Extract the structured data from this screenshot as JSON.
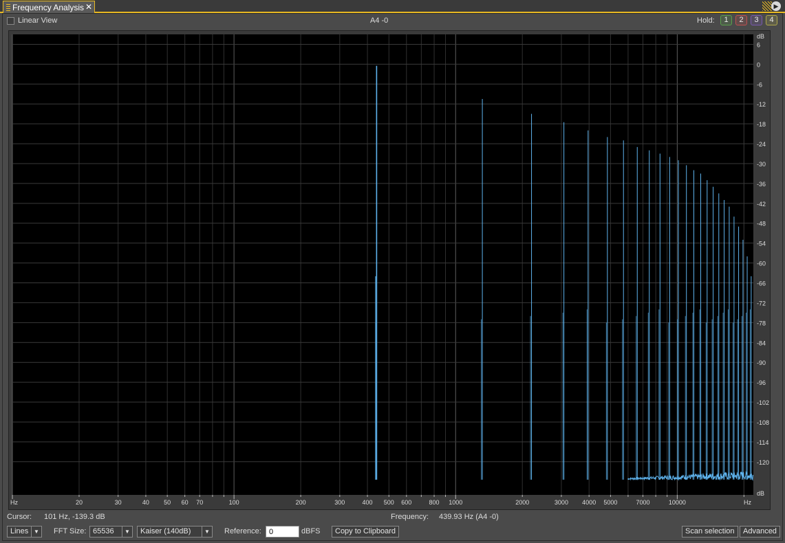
{
  "tab": {
    "title": "Frequency Analysis",
    "close_glyph": "✕"
  },
  "toolbar": {
    "linear_view_label": "Linear View",
    "note_readout": "A4 -0",
    "hold_label": "Hold:",
    "hold_buttons": [
      {
        "label": "1",
        "color": "#5aa04a"
      },
      {
        "label": "2",
        "color": "#c05050"
      },
      {
        "label": "3",
        "color": "#7a5ab0"
      },
      {
        "label": "4",
        "color": "#b0a84a"
      }
    ]
  },
  "status": {
    "cursor_label": "Cursor:",
    "cursor_value": "101 Hz, -139.3 dB",
    "frequency_label": "Frequency:",
    "frequency_value": "439.93 Hz (A4 -0)"
  },
  "controls": {
    "display_mode": "Lines",
    "fft_size_label": "FFT Size:",
    "fft_size": "65536",
    "window": "Kaiser (140dB)",
    "reference_label": "Reference:",
    "reference_value": "0",
    "reference_unit": "dBFS",
    "copy_button": "Copy to Clipboard",
    "scan_button": "Scan selection",
    "advanced_button": "Advanced"
  },
  "chart_data": {
    "type": "line",
    "x_scale": "log",
    "xlim": [
      10,
      22050
    ],
    "ylim": [
      -130,
      9
    ],
    "x_axis_unit_left": "Hz",
    "x_axis_unit_right": "Hz",
    "y_axis_unit_top": "dB",
    "y_axis_unit_bottom": "dB",
    "x_tick_labels": [
      {
        "value": 20,
        "label": "20"
      },
      {
        "value": 30,
        "label": "30"
      },
      {
        "value": 40,
        "label": "40"
      },
      {
        "value": 50,
        "label": "50"
      },
      {
        "value": 60,
        "label": "60"
      },
      {
        "value": 70,
        "label": "70"
      },
      {
        "value": 100,
        "label": "100"
      },
      {
        "value": 200,
        "label": "200"
      },
      {
        "value": 300,
        "label": "300"
      },
      {
        "value": 400,
        "label": "400"
      },
      {
        "value": 500,
        "label": "500"
      },
      {
        "value": 600,
        "label": "600"
      },
      {
        "value": 800,
        "label": "800"
      },
      {
        "value": 1000,
        "label": "1000"
      },
      {
        "value": 2000,
        "label": "2000"
      },
      {
        "value": 3000,
        "label": "3000"
      },
      {
        "value": 4000,
        "label": "4000"
      },
      {
        "value": 5000,
        "label": "5000"
      },
      {
        "value": 7000,
        "label": "7000"
      },
      {
        "value": 10000,
        "label": "10000"
      }
    ],
    "y_ticks": [
      6,
      0,
      -6,
      -12,
      -18,
      -24,
      -30,
      -36,
      -42,
      -48,
      -54,
      -60,
      -66,
      -72,
      -78,
      -84,
      -90,
      -96,
      -102,
      -108,
      -114,
      -120
    ],
    "grid": true,
    "series": [
      {
        "color": "#5fb4ee",
        "peaks": [
          {
            "x": 440,
            "y": -0.5
          },
          {
            "x": 1320,
            "y": -10.5
          },
          {
            "x": 2200,
            "y": -15
          },
          {
            "x": 3080,
            "y": -17.5
          },
          {
            "x": 3960,
            "y": -20
          },
          {
            "x": 4840,
            "y": -22
          },
          {
            "x": 5720,
            "y": -23
          },
          {
            "x": 6600,
            "y": -25
          },
          {
            "x": 7480,
            "y": -26
          },
          {
            "x": 8360,
            "y": -27
          },
          {
            "x": 9240,
            "y": -28
          },
          {
            "x": 10120,
            "y": -29
          },
          {
            "x": 11000,
            "y": -30.5
          },
          {
            "x": 11880,
            "y": -32
          },
          {
            "x": 12760,
            "y": -33
          },
          {
            "x": 13640,
            "y": -35
          },
          {
            "x": 14520,
            "y": -37
          },
          {
            "x": 15400,
            "y": -39
          },
          {
            "x": 16280,
            "y": -41
          },
          {
            "x": 17160,
            "y": -43
          },
          {
            "x": 18040,
            "y": -46
          },
          {
            "x": 18920,
            "y": -49
          },
          {
            "x": 19800,
            "y": -53
          },
          {
            "x": 20680,
            "y": -58
          },
          {
            "x": 21560,
            "y": -64
          }
        ],
        "noise_floor_db": -125
      }
    ]
  }
}
